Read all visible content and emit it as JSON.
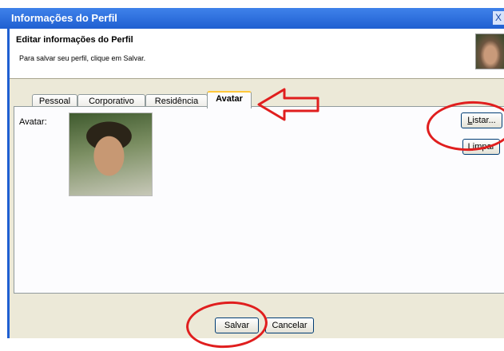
{
  "window": {
    "title": "Informações do Perfil",
    "close_glyph": "X"
  },
  "header": {
    "title": "Editar informações do Perfil",
    "subtitle": "Para salvar seu perfil, clique em Salvar."
  },
  "tabs": [
    {
      "label": "Pessoal",
      "active": false
    },
    {
      "label": "Corporativo",
      "active": false
    },
    {
      "label": "Residência",
      "active": false
    },
    {
      "label": "Avatar",
      "active": true
    }
  ],
  "avatar": {
    "label": "Avatar:"
  },
  "buttons": {
    "listar": {
      "accel": "L",
      "rest": "istar..."
    },
    "limpar": {
      "accel": "L",
      "rest": "impar"
    },
    "salvar": "Salvar",
    "cancelar": "Cancelar"
  },
  "annotations": {
    "color": "#e01e1e"
  }
}
